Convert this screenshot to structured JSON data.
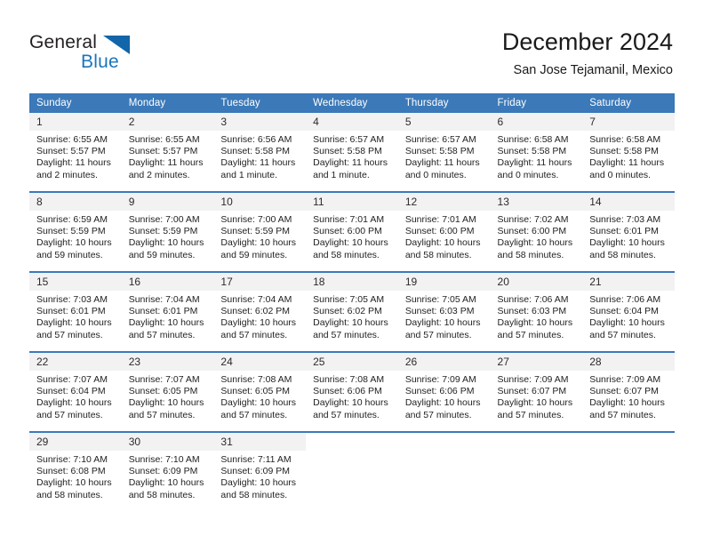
{
  "logo": {
    "word_one": "General",
    "word_two": "Blue",
    "triangle_color": "#1265a8",
    "blue_color": "#1b75bb"
  },
  "header": {
    "title": "December 2024",
    "subtitle": "San Jose Tejamanil, Mexico"
  },
  "colors": {
    "header_blue": "#3b79b8",
    "daynum_band": "#f2f2f2",
    "text": "#1a1a1a"
  },
  "weekdays": [
    "Sunday",
    "Monday",
    "Tuesday",
    "Wednesday",
    "Thursday",
    "Friday",
    "Saturday"
  ],
  "labels": {
    "sunrise_prefix": "Sunrise: ",
    "sunset_prefix": "Sunset: ",
    "daylight_prefix": "Daylight: "
  },
  "weeks": [
    [
      {
        "day": "1",
        "sunrise": "Sunrise: 6:55 AM",
        "sunset": "Sunset: 5:57 PM",
        "daylight1": "Daylight: 11 hours",
        "daylight2": "and 2 minutes."
      },
      {
        "day": "2",
        "sunrise": "Sunrise: 6:55 AM",
        "sunset": "Sunset: 5:57 PM",
        "daylight1": "Daylight: 11 hours",
        "daylight2": "and 2 minutes."
      },
      {
        "day": "3",
        "sunrise": "Sunrise: 6:56 AM",
        "sunset": "Sunset: 5:58 PM",
        "daylight1": "Daylight: 11 hours",
        "daylight2": "and 1 minute."
      },
      {
        "day": "4",
        "sunrise": "Sunrise: 6:57 AM",
        "sunset": "Sunset: 5:58 PM",
        "daylight1": "Daylight: 11 hours",
        "daylight2": "and 1 minute."
      },
      {
        "day": "5",
        "sunrise": "Sunrise: 6:57 AM",
        "sunset": "Sunset: 5:58 PM",
        "daylight1": "Daylight: 11 hours",
        "daylight2": "and 0 minutes."
      },
      {
        "day": "6",
        "sunrise": "Sunrise: 6:58 AM",
        "sunset": "Sunset: 5:58 PM",
        "daylight1": "Daylight: 11 hours",
        "daylight2": "and 0 minutes."
      },
      {
        "day": "7",
        "sunrise": "Sunrise: 6:58 AM",
        "sunset": "Sunset: 5:58 PM",
        "daylight1": "Daylight: 11 hours",
        "daylight2": "and 0 minutes."
      }
    ],
    [
      {
        "day": "8",
        "sunrise": "Sunrise: 6:59 AM",
        "sunset": "Sunset: 5:59 PM",
        "daylight1": "Daylight: 10 hours",
        "daylight2": "and 59 minutes."
      },
      {
        "day": "9",
        "sunrise": "Sunrise: 7:00 AM",
        "sunset": "Sunset: 5:59 PM",
        "daylight1": "Daylight: 10 hours",
        "daylight2": "and 59 minutes."
      },
      {
        "day": "10",
        "sunrise": "Sunrise: 7:00 AM",
        "sunset": "Sunset: 5:59 PM",
        "daylight1": "Daylight: 10 hours",
        "daylight2": "and 59 minutes."
      },
      {
        "day": "11",
        "sunrise": "Sunrise: 7:01 AM",
        "sunset": "Sunset: 6:00 PM",
        "daylight1": "Daylight: 10 hours",
        "daylight2": "and 58 minutes."
      },
      {
        "day": "12",
        "sunrise": "Sunrise: 7:01 AM",
        "sunset": "Sunset: 6:00 PM",
        "daylight1": "Daylight: 10 hours",
        "daylight2": "and 58 minutes."
      },
      {
        "day": "13",
        "sunrise": "Sunrise: 7:02 AM",
        "sunset": "Sunset: 6:00 PM",
        "daylight1": "Daylight: 10 hours",
        "daylight2": "and 58 minutes."
      },
      {
        "day": "14",
        "sunrise": "Sunrise: 7:03 AM",
        "sunset": "Sunset: 6:01 PM",
        "daylight1": "Daylight: 10 hours",
        "daylight2": "and 58 minutes."
      }
    ],
    [
      {
        "day": "15",
        "sunrise": "Sunrise: 7:03 AM",
        "sunset": "Sunset: 6:01 PM",
        "daylight1": "Daylight: 10 hours",
        "daylight2": "and 57 minutes."
      },
      {
        "day": "16",
        "sunrise": "Sunrise: 7:04 AM",
        "sunset": "Sunset: 6:01 PM",
        "daylight1": "Daylight: 10 hours",
        "daylight2": "and 57 minutes."
      },
      {
        "day": "17",
        "sunrise": "Sunrise: 7:04 AM",
        "sunset": "Sunset: 6:02 PM",
        "daylight1": "Daylight: 10 hours",
        "daylight2": "and 57 minutes."
      },
      {
        "day": "18",
        "sunrise": "Sunrise: 7:05 AM",
        "sunset": "Sunset: 6:02 PM",
        "daylight1": "Daylight: 10 hours",
        "daylight2": "and 57 minutes."
      },
      {
        "day": "19",
        "sunrise": "Sunrise: 7:05 AM",
        "sunset": "Sunset: 6:03 PM",
        "daylight1": "Daylight: 10 hours",
        "daylight2": "and 57 minutes."
      },
      {
        "day": "20",
        "sunrise": "Sunrise: 7:06 AM",
        "sunset": "Sunset: 6:03 PM",
        "daylight1": "Daylight: 10 hours",
        "daylight2": "and 57 minutes."
      },
      {
        "day": "21",
        "sunrise": "Sunrise: 7:06 AM",
        "sunset": "Sunset: 6:04 PM",
        "daylight1": "Daylight: 10 hours",
        "daylight2": "and 57 minutes."
      }
    ],
    [
      {
        "day": "22",
        "sunrise": "Sunrise: 7:07 AM",
        "sunset": "Sunset: 6:04 PM",
        "daylight1": "Daylight: 10 hours",
        "daylight2": "and 57 minutes."
      },
      {
        "day": "23",
        "sunrise": "Sunrise: 7:07 AM",
        "sunset": "Sunset: 6:05 PM",
        "daylight1": "Daylight: 10 hours",
        "daylight2": "and 57 minutes."
      },
      {
        "day": "24",
        "sunrise": "Sunrise: 7:08 AM",
        "sunset": "Sunset: 6:05 PM",
        "daylight1": "Daylight: 10 hours",
        "daylight2": "and 57 minutes."
      },
      {
        "day": "25",
        "sunrise": "Sunrise: 7:08 AM",
        "sunset": "Sunset: 6:06 PM",
        "daylight1": "Daylight: 10 hours",
        "daylight2": "and 57 minutes."
      },
      {
        "day": "26",
        "sunrise": "Sunrise: 7:09 AM",
        "sunset": "Sunset: 6:06 PM",
        "daylight1": "Daylight: 10 hours",
        "daylight2": "and 57 minutes."
      },
      {
        "day": "27",
        "sunrise": "Sunrise: 7:09 AM",
        "sunset": "Sunset: 6:07 PM",
        "daylight1": "Daylight: 10 hours",
        "daylight2": "and 57 minutes."
      },
      {
        "day": "28",
        "sunrise": "Sunrise: 7:09 AM",
        "sunset": "Sunset: 6:07 PM",
        "daylight1": "Daylight: 10 hours",
        "daylight2": "and 57 minutes."
      }
    ],
    [
      {
        "day": "29",
        "sunrise": "Sunrise: 7:10 AM",
        "sunset": "Sunset: 6:08 PM",
        "daylight1": "Daylight: 10 hours",
        "daylight2": "and 58 minutes."
      },
      {
        "day": "30",
        "sunrise": "Sunrise: 7:10 AM",
        "sunset": "Sunset: 6:09 PM",
        "daylight1": "Daylight: 10 hours",
        "daylight2": "and 58 minutes."
      },
      {
        "day": "31",
        "sunrise": "Sunrise: 7:11 AM",
        "sunset": "Sunset: 6:09 PM",
        "daylight1": "Daylight: 10 hours",
        "daylight2": "and 58 minutes."
      },
      {
        "day": "",
        "sunrise": "",
        "sunset": "",
        "daylight1": "",
        "daylight2": ""
      },
      {
        "day": "",
        "sunrise": "",
        "sunset": "",
        "daylight1": "",
        "daylight2": ""
      },
      {
        "day": "",
        "sunrise": "",
        "sunset": "",
        "daylight1": "",
        "daylight2": ""
      },
      {
        "day": "",
        "sunrise": "",
        "sunset": "",
        "daylight1": "",
        "daylight2": ""
      }
    ]
  ]
}
